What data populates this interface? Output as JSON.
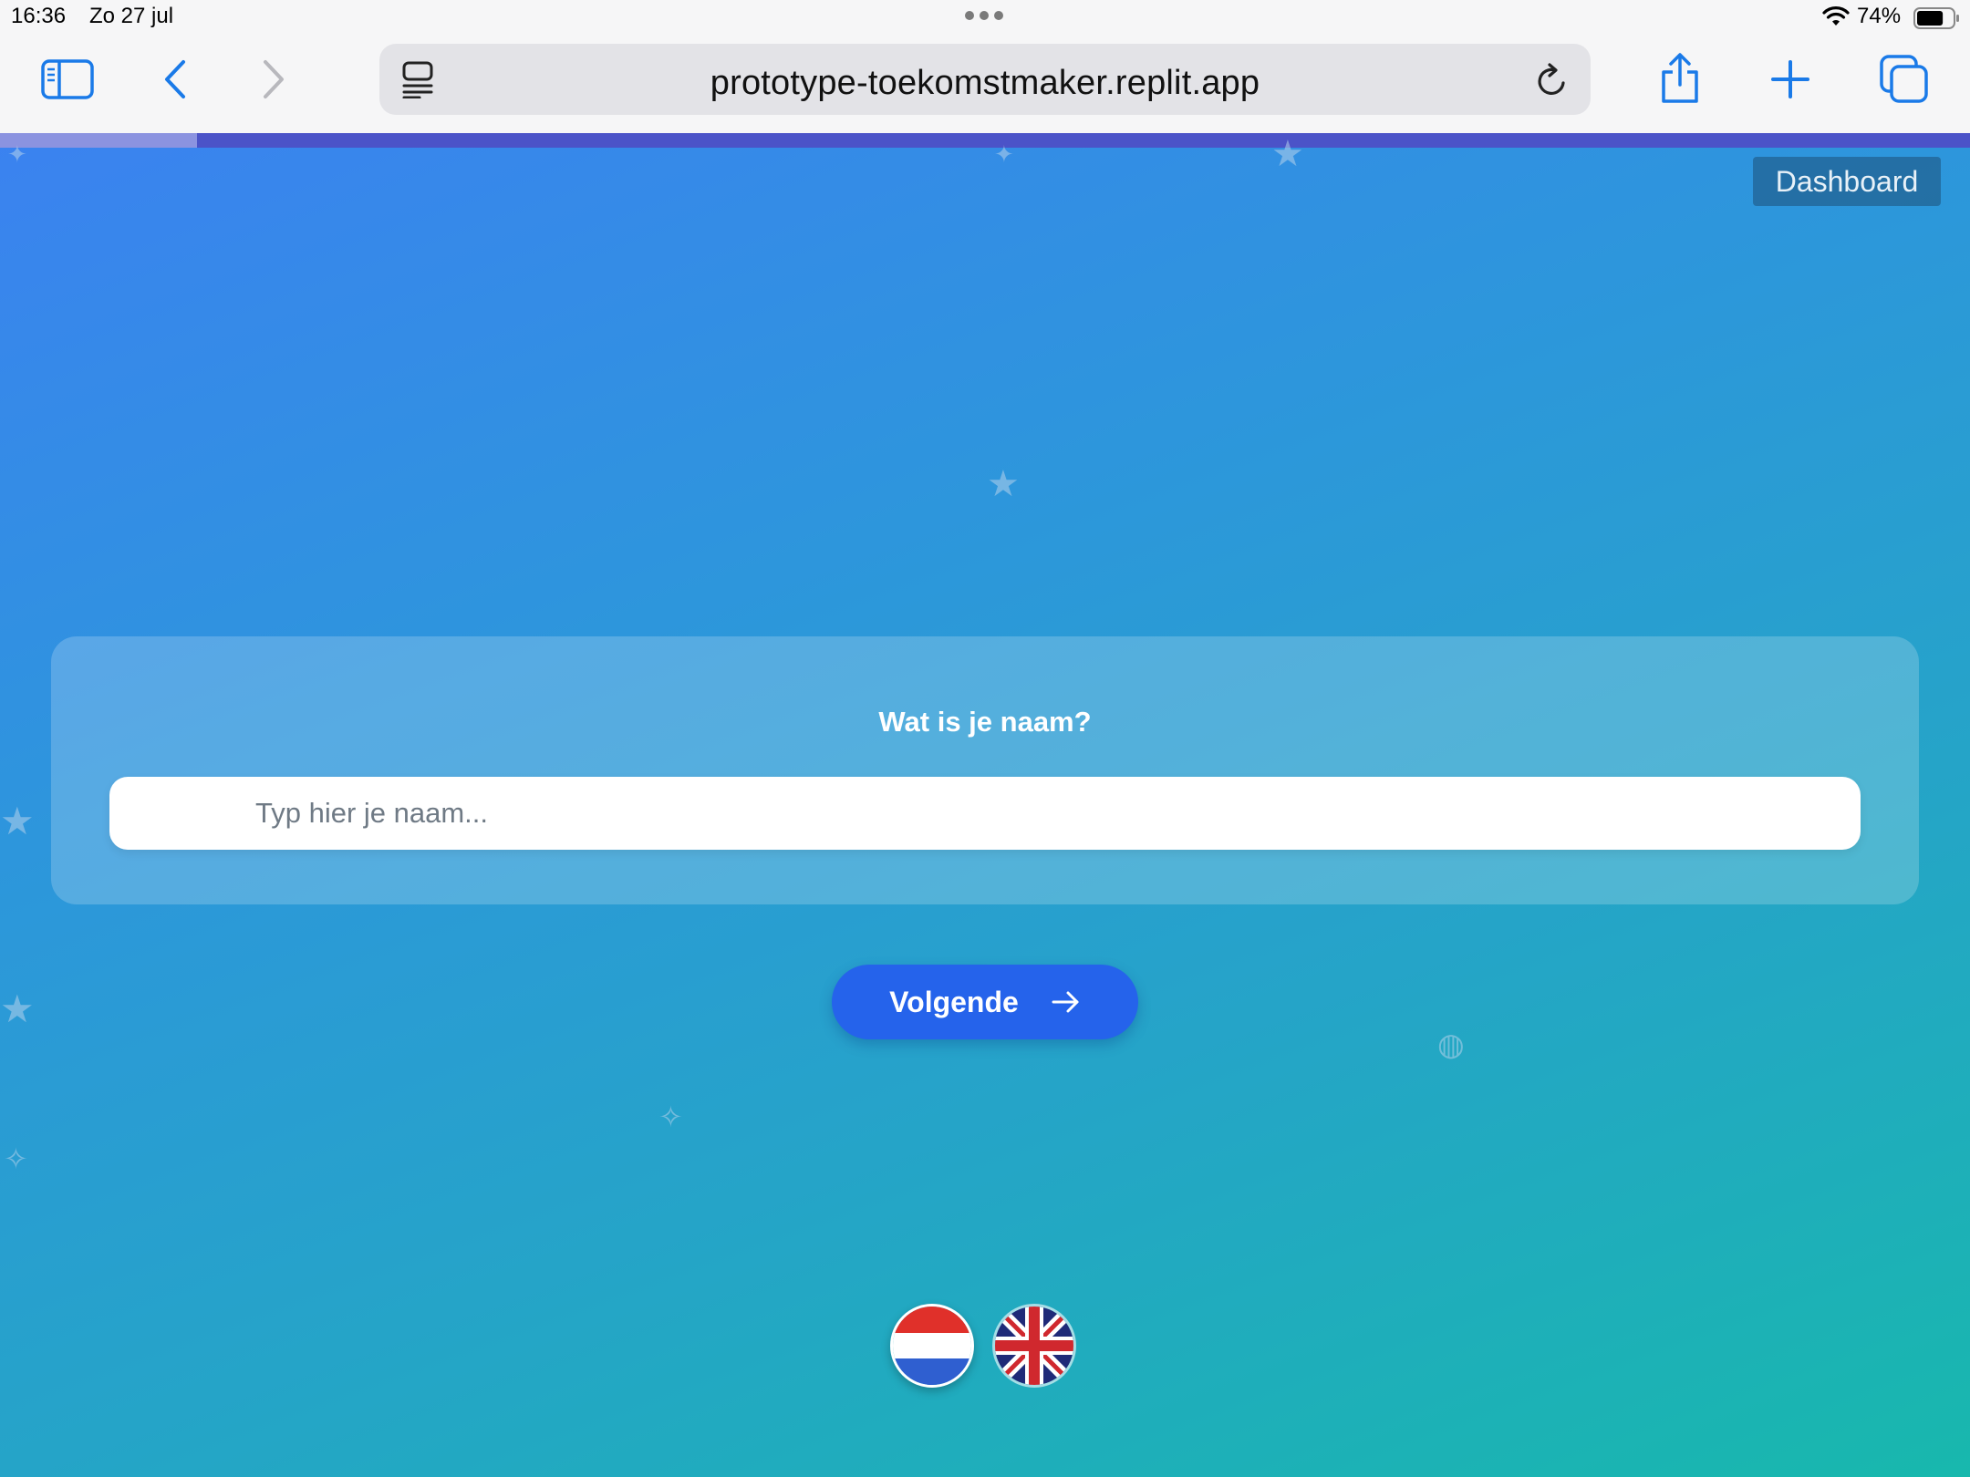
{
  "status_bar": {
    "time": "16:36",
    "date": "Zo 27 jul",
    "battery": "74%",
    "battery_level": 0.74
  },
  "browser": {
    "url": "prototype-toekomstmaker.replit.app",
    "accent_color": "#1a7ae8"
  },
  "page": {
    "progress": 0.1,
    "dashboard_label": "Dashboard",
    "question": "Wat is je naam?",
    "name_input": {
      "value": "",
      "placeholder": "Typ hier je naam..."
    },
    "next_label": "Volgende",
    "languages": [
      {
        "code": "nl",
        "icon": "flag-netherlands-icon"
      },
      {
        "code": "en",
        "icon": "flag-uk-icon"
      }
    ]
  },
  "colors": {
    "primary_button": "#2563eb",
    "gradient_start": "#3b82f0",
    "gradient_end": "#18b8ad"
  }
}
